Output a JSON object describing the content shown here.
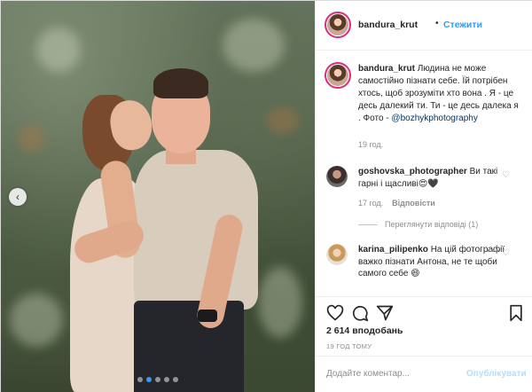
{
  "post": {
    "username": "bandura_krut",
    "separator": "•",
    "follow_label": "Стежити",
    "caption_username": "bandura_krut",
    "caption_text": "Людина не може самостійно пізнати себе. Їй потрібен хтось, щоб зрозуміти хто вона . Я - це десь далекий ти. Ти - це десь далека я . Фото -",
    "caption_mention": "@bozhykphotography",
    "caption_time": "19 год.",
    "likes": "2 614 вподобань",
    "time_ago": "19 ГОД ТОМУ",
    "add_comment_placeholder": "Додайте коментар...",
    "publish_label": "Опублікувати"
  },
  "comments": [
    {
      "username": "goshovska_photographer",
      "text": "Ви такі гарні і щасливі😍🖤",
      "time": "17 год.",
      "reply_label": "Відповісти",
      "view_replies": "Переглянути відповіді (1)"
    },
    {
      "username": "karina_pilipenko",
      "text": "На цій фотографії важко пізнати Антона, не те щоби самого себе 😄"
    }
  ],
  "icons": {
    "prev": "chevron-left-icon",
    "like": "heart-icon",
    "comment": "comment-icon",
    "share": "paper-plane-icon",
    "save": "bookmark-icon"
  },
  "colors": {
    "link": "#3897f0",
    "mention": "#003569",
    "muted": "#8e8e8e",
    "story_ring": "#d82d7e"
  },
  "carousel": {
    "slides": 5,
    "active_index": 1
  }
}
